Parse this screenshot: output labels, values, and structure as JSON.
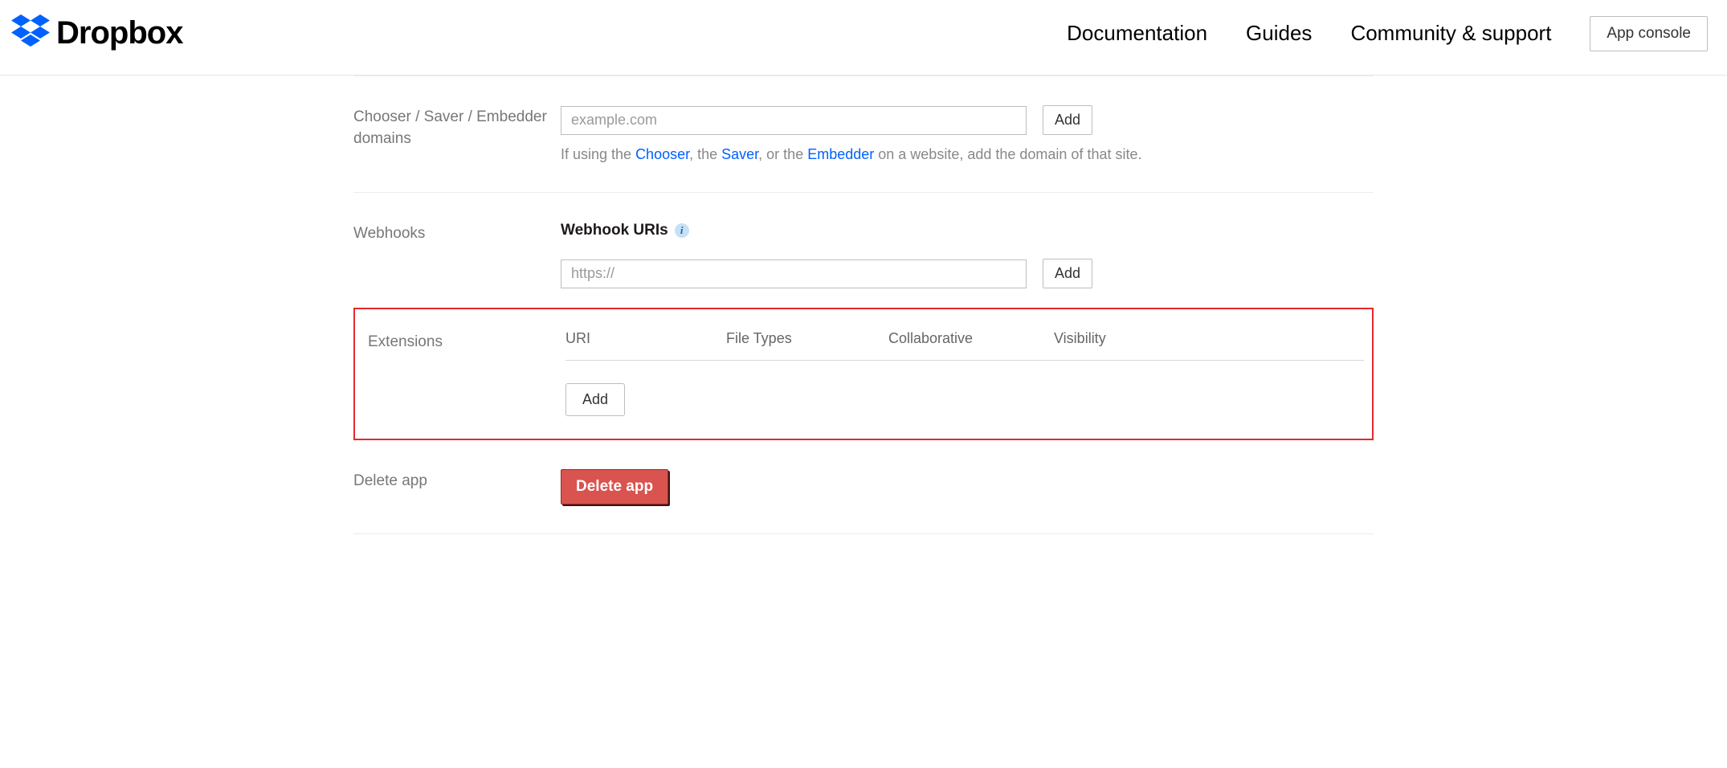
{
  "brand": "Dropbox",
  "nav": {
    "documentation": "Documentation",
    "guides": "Guides",
    "community": "Community & support",
    "app_console": "App console"
  },
  "sections": {
    "domains": {
      "label": "Chooser / Saver / Embedder domains",
      "placeholder": "example.com",
      "add": "Add",
      "help_prefix": "If using the ",
      "link_chooser": "Chooser",
      "help_mid1": ", the ",
      "link_saver": "Saver",
      "help_mid2": ", or the ",
      "link_embedder": "Embedder",
      "help_suffix": " on a website, add the domain of that site."
    },
    "webhooks": {
      "label": "Webhooks",
      "heading": "Webhook URIs",
      "placeholder": "https://",
      "add": "Add"
    },
    "extensions": {
      "label": "Extensions",
      "col_uri": "URI",
      "col_filetypes": "File Types",
      "col_collab": "Collaborative",
      "col_visibility": "Visibility",
      "add": "Add"
    },
    "delete": {
      "label": "Delete app",
      "button": "Delete app"
    }
  }
}
